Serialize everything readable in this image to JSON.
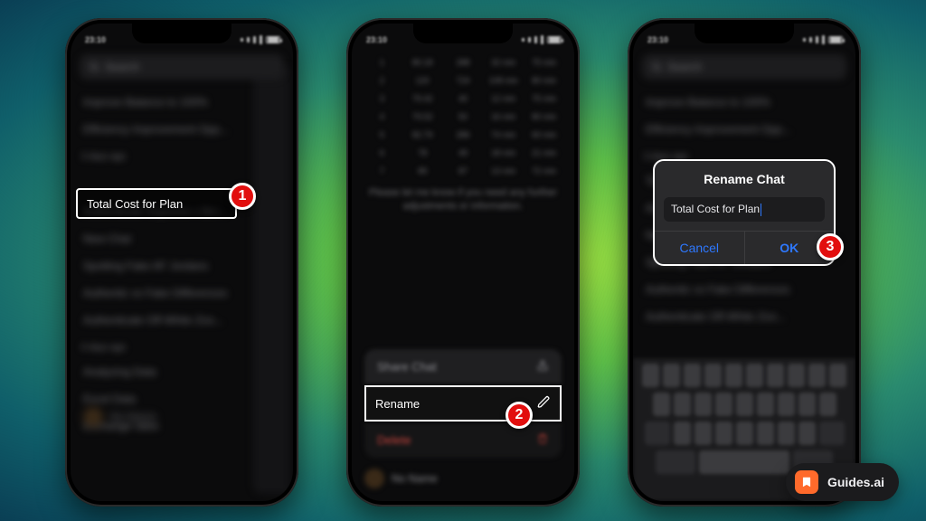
{
  "status": {
    "time": "23:10",
    "carrier_label": "▪▪"
  },
  "phone1": {
    "search_placeholder": "Search",
    "highlighted_chat": "Total Cost for Plan",
    "blurred_items": {
      "a": "Improve Balance to 100%",
      "b": "Efficiency Improvement Opp...",
      "section1": "3 days ago",
      "c": "Authenticate Supreme x Bm...",
      "d": "New Chat",
      "e": "Spotting Fake AF Jordans",
      "f": "Authentic vs Fake Differences",
      "g": "Authenticate Off-White Zoo...",
      "section2": "6 days ago",
      "h": "Analyzing Data",
      "i": "Excel Data",
      "j": "Exchange rates",
      "footer_name": "No Name"
    }
  },
  "phone2": {
    "info": "Please let me know if you need any further adjustments or information.",
    "sheet": {
      "share": "Share Chat",
      "rename": "Rename",
      "delete": "Delete"
    },
    "footer_name": "No Name"
  },
  "phone3": {
    "alert_title": "Rename Chat",
    "alert_value": "Total Cost for Plan",
    "cancel": "Cancel",
    "ok": "OK"
  },
  "badges": {
    "one": "1",
    "two": "2",
    "three": "3"
  },
  "brand": "Guides.ai"
}
